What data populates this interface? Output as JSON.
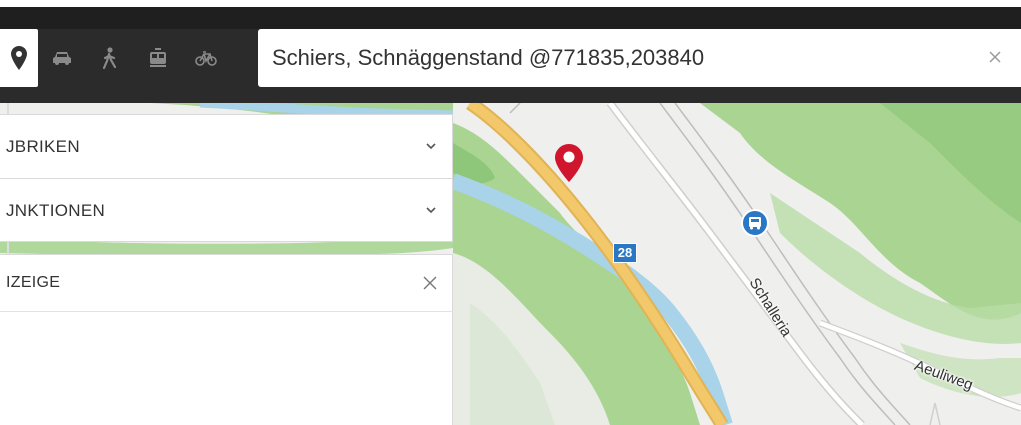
{
  "topbar": {
    "modes": [
      {
        "name": "location",
        "icon": "map-pin-icon",
        "active": true
      },
      {
        "name": "car",
        "icon": "car-icon",
        "active": false
      },
      {
        "name": "walk",
        "icon": "walking-person-icon",
        "active": false
      },
      {
        "name": "public-transport",
        "icon": "tram-icon",
        "active": false
      },
      {
        "name": "bike",
        "icon": "bicycle-icon",
        "active": false
      }
    ],
    "search": {
      "value": "Schiers, Schnäggenstand @771835,203840",
      "clear_icon": "close-icon"
    }
  },
  "sidebar": {
    "rubriken_label": "JBRIKEN",
    "funktionen_label": "JNKTIONEN",
    "anzeige_label": "IZEIGE"
  },
  "map": {
    "route_shield": "28",
    "streets": [
      "Schalleria",
      "Aeuliweg"
    ],
    "pin_color": "#d0162f",
    "road_color": "#f3c86a",
    "river_color": "#a8d3e8",
    "forest_color": "#9ccf87",
    "bus_icon": "bus-stop-icon"
  },
  "colors": {
    "topbar": "#2b2b2b",
    "accent_blue": "#2a78c5"
  }
}
